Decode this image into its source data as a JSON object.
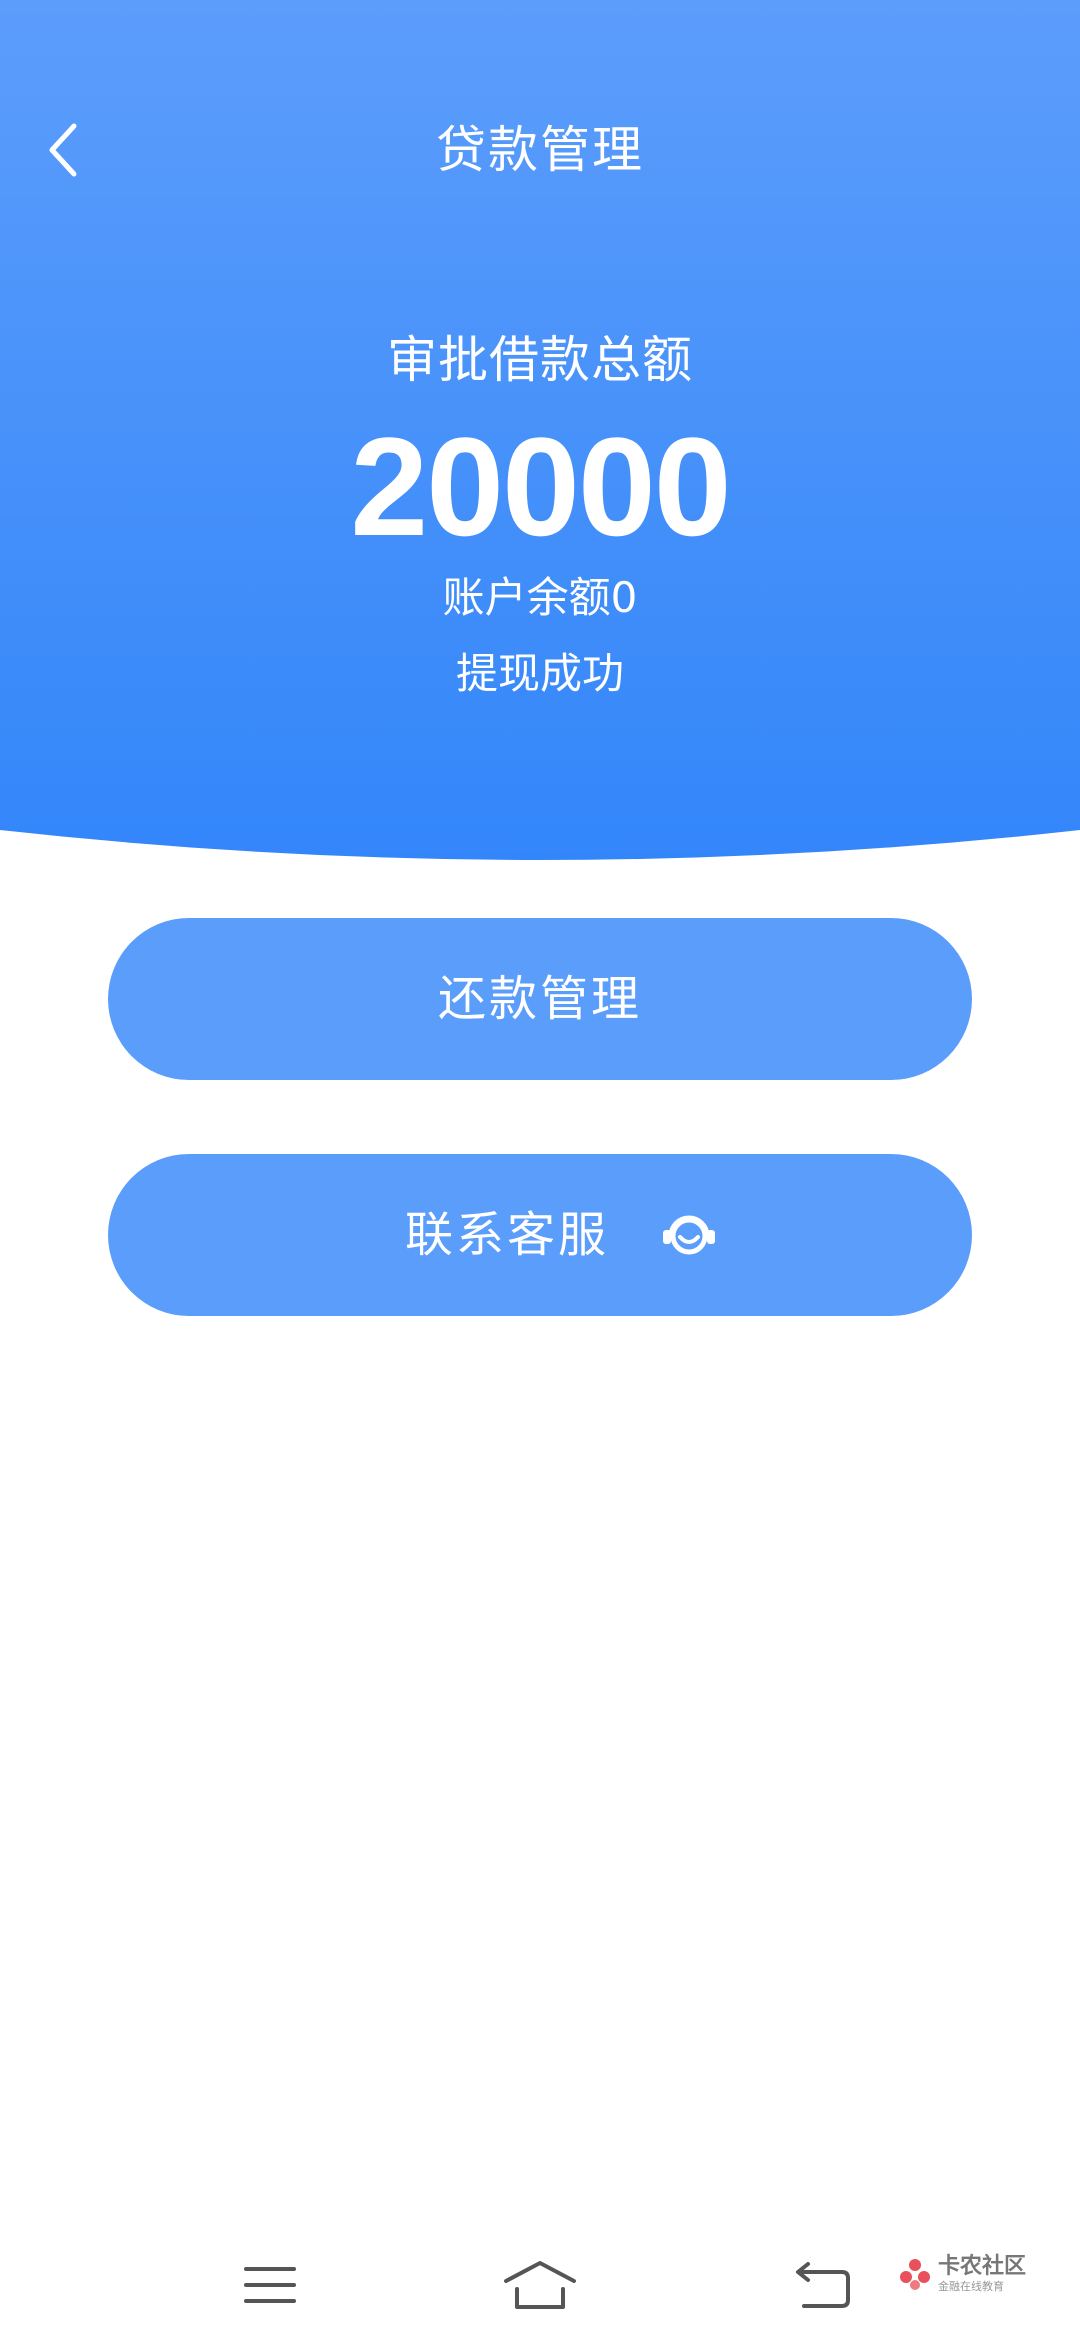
{
  "header": {
    "title": "贷款管理"
  },
  "summary": {
    "label": "审批借款总额",
    "amount": "20000",
    "balance": "账户余额0",
    "status": "提现成功"
  },
  "actions": {
    "repay_label": "还款管理",
    "service_label": "联系客服"
  },
  "icons": {
    "back": "chevron-left-icon",
    "service": "customer-service-icon",
    "nav_menu": "menu-icon",
    "nav_home": "home-icon",
    "nav_back": "back-arrow-icon"
  },
  "watermark": {
    "title": "卡农社区",
    "subtitle": "金融在线教育"
  },
  "colors": {
    "header_top": "#5b9cfb",
    "header_bottom": "#3386fa",
    "button": "#5b9dfb",
    "nav_icon": "#555555"
  }
}
